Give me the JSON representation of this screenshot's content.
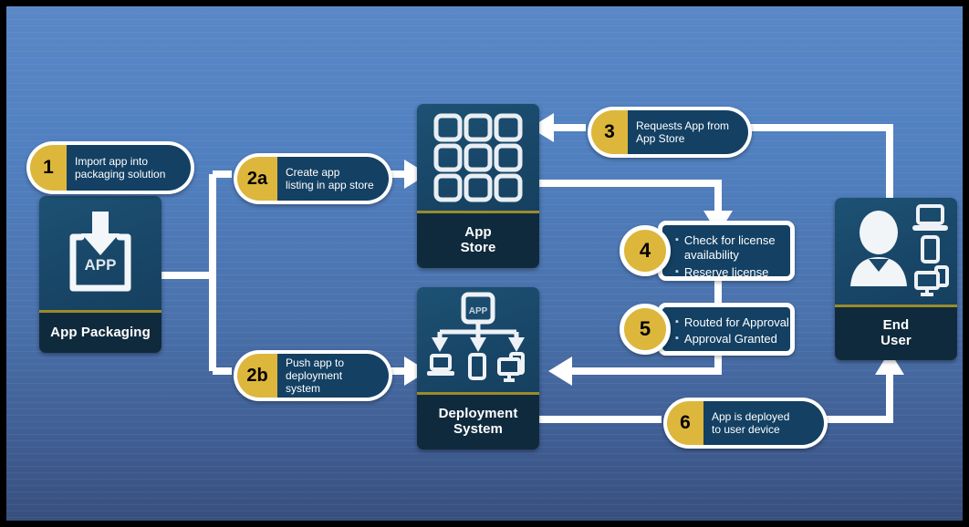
{
  "diagram": {
    "title": "App packaging, app store, deployment and end user workflow",
    "colors": {
      "background_top": "#5a87c6",
      "background_bottom": "#384f7e",
      "border": "#000000",
      "badge_gold": "#ddb63c",
      "callout_navy": "#134063",
      "node_icon_teal": "#19486a",
      "node_label_navy": "#102a3d",
      "node_divider_gold": "#9a8b2b",
      "connector_white": "#ffffff"
    }
  },
  "nodes": [
    {
      "id": "app-packaging",
      "label": "App Packaging",
      "icon": "app-download-box-icon",
      "icon_text": "APP"
    },
    {
      "id": "app-store",
      "label": "App\nStore",
      "label_line1": "App",
      "label_line2": "Store",
      "icon": "app-grid-icon"
    },
    {
      "id": "deployment-system",
      "label": "Deployment\nSystem",
      "label_line1": "Deployment",
      "label_line2": "System",
      "icon": "app-distribution-devices-icon",
      "icon_text": "APP"
    },
    {
      "id": "end-user",
      "label": "End\nUser",
      "label_line1": "End",
      "label_line2": "User",
      "icon": "user-devices-icon"
    }
  ],
  "steps": [
    {
      "id": "step-1",
      "number": "1",
      "style": "pill",
      "line1": "Import app into",
      "line2": "packaging solution"
    },
    {
      "id": "step-2a",
      "number": "2a",
      "style": "pill",
      "line1": "Create app",
      "line2": "listing in app store"
    },
    {
      "id": "step-2b",
      "number": "2b",
      "style": "pill",
      "line1": "Push app to",
      "line2": "deployment system"
    },
    {
      "id": "step-3",
      "number": "3",
      "style": "pill",
      "line1": "Requests App from",
      "line2": "App Store"
    },
    {
      "id": "step-4",
      "number": "4",
      "style": "bullets",
      "bullets": [
        "Check for license availability",
        "Reserve license"
      ],
      "bullet1_line1": "Check for license",
      "bullet1_line2": "availability",
      "bullet2_line1": "Reserve license"
    },
    {
      "id": "step-5",
      "number": "5",
      "style": "bullets",
      "bullets": [
        "Routed for Approval",
        "Approval Granted"
      ],
      "bullet1_line1": "Routed for Approval",
      "bullet2_line1": "Approval Granted"
    },
    {
      "id": "step-6",
      "number": "6",
      "style": "pill",
      "line1": "App is deployed",
      "line2": "to user device"
    }
  ]
}
